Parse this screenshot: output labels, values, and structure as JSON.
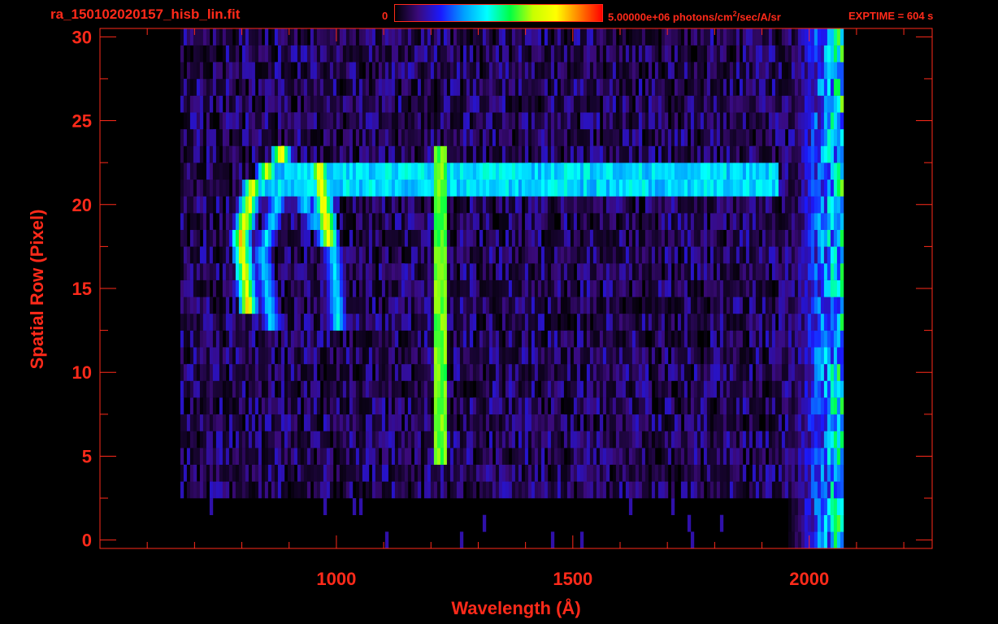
{
  "header": {
    "filename": "ra_150102020157_hisb_lin.fit",
    "colorbar_min": "0",
    "colorbar_max_prefix": "5.00000e+06 photons/cm",
    "colorbar_max_sup": "2",
    "colorbar_max_suffix": "/sec/A/sr",
    "exptime": "EXPTIME = 604 s"
  },
  "colors": {
    "axis": "#ff2a1a",
    "background": "#000000",
    "colormap": [
      "#000000",
      "#3a0a7a",
      "#1a1aff",
      "#00a0ff",
      "#00ffff",
      "#00ff44",
      "#c8ff00",
      "#ffff00",
      "#ff8000",
      "#ff0000"
    ]
  },
  "chart_data": {
    "type": "heatmap",
    "title": "",
    "xlabel": "Wavelength (Å)",
    "ylabel": "Spatial Row (Pixel)",
    "xlim": [
      500,
      2260
    ],
    "ylim": [
      -0.5,
      30.5
    ],
    "xticks": [
      1000,
      1500,
      2000
    ],
    "yticks": [
      0,
      5,
      10,
      15,
      20,
      25,
      30
    ],
    "colorbar_range": [
      0,
      5000000
    ],
    "colorbar_unit": "photons/cm^2/sec/A/sr",
    "features": [
      {
        "type": "background",
        "x_range": [
          670,
          2070
        ],
        "y_range": [
          3,
          30
        ],
        "level": 0.12
      },
      {
        "type": "edge",
        "x_range": [
          1950,
          2070
        ],
        "y_range": [
          0,
          30
        ],
        "level": 0.45
      },
      {
        "type": "band",
        "x_range": [
          840,
          1930
        ],
        "rows": [
          21,
          22
        ],
        "level": 0.4
      },
      {
        "type": "line",
        "x": 1215,
        "y_range": [
          5,
          23
        ],
        "level": 0.62
      },
      {
        "type": "arc",
        "x_points": [
          [
            810,
            14
          ],
          [
            795,
            18
          ],
          [
            820,
            21
          ],
          [
            880,
            23
          ],
          [
            960,
            22
          ],
          [
            980,
            18
          ]
        ],
        "level": 0.85
      },
      {
        "type": "arc",
        "x_points": [
          [
            860,
            13
          ],
          [
            840,
            17
          ],
          [
            880,
            21
          ],
          [
            930,
            20
          ],
          [
            990,
            17
          ],
          [
            1000,
            13
          ]
        ],
        "level": 0.45
      }
    ]
  }
}
